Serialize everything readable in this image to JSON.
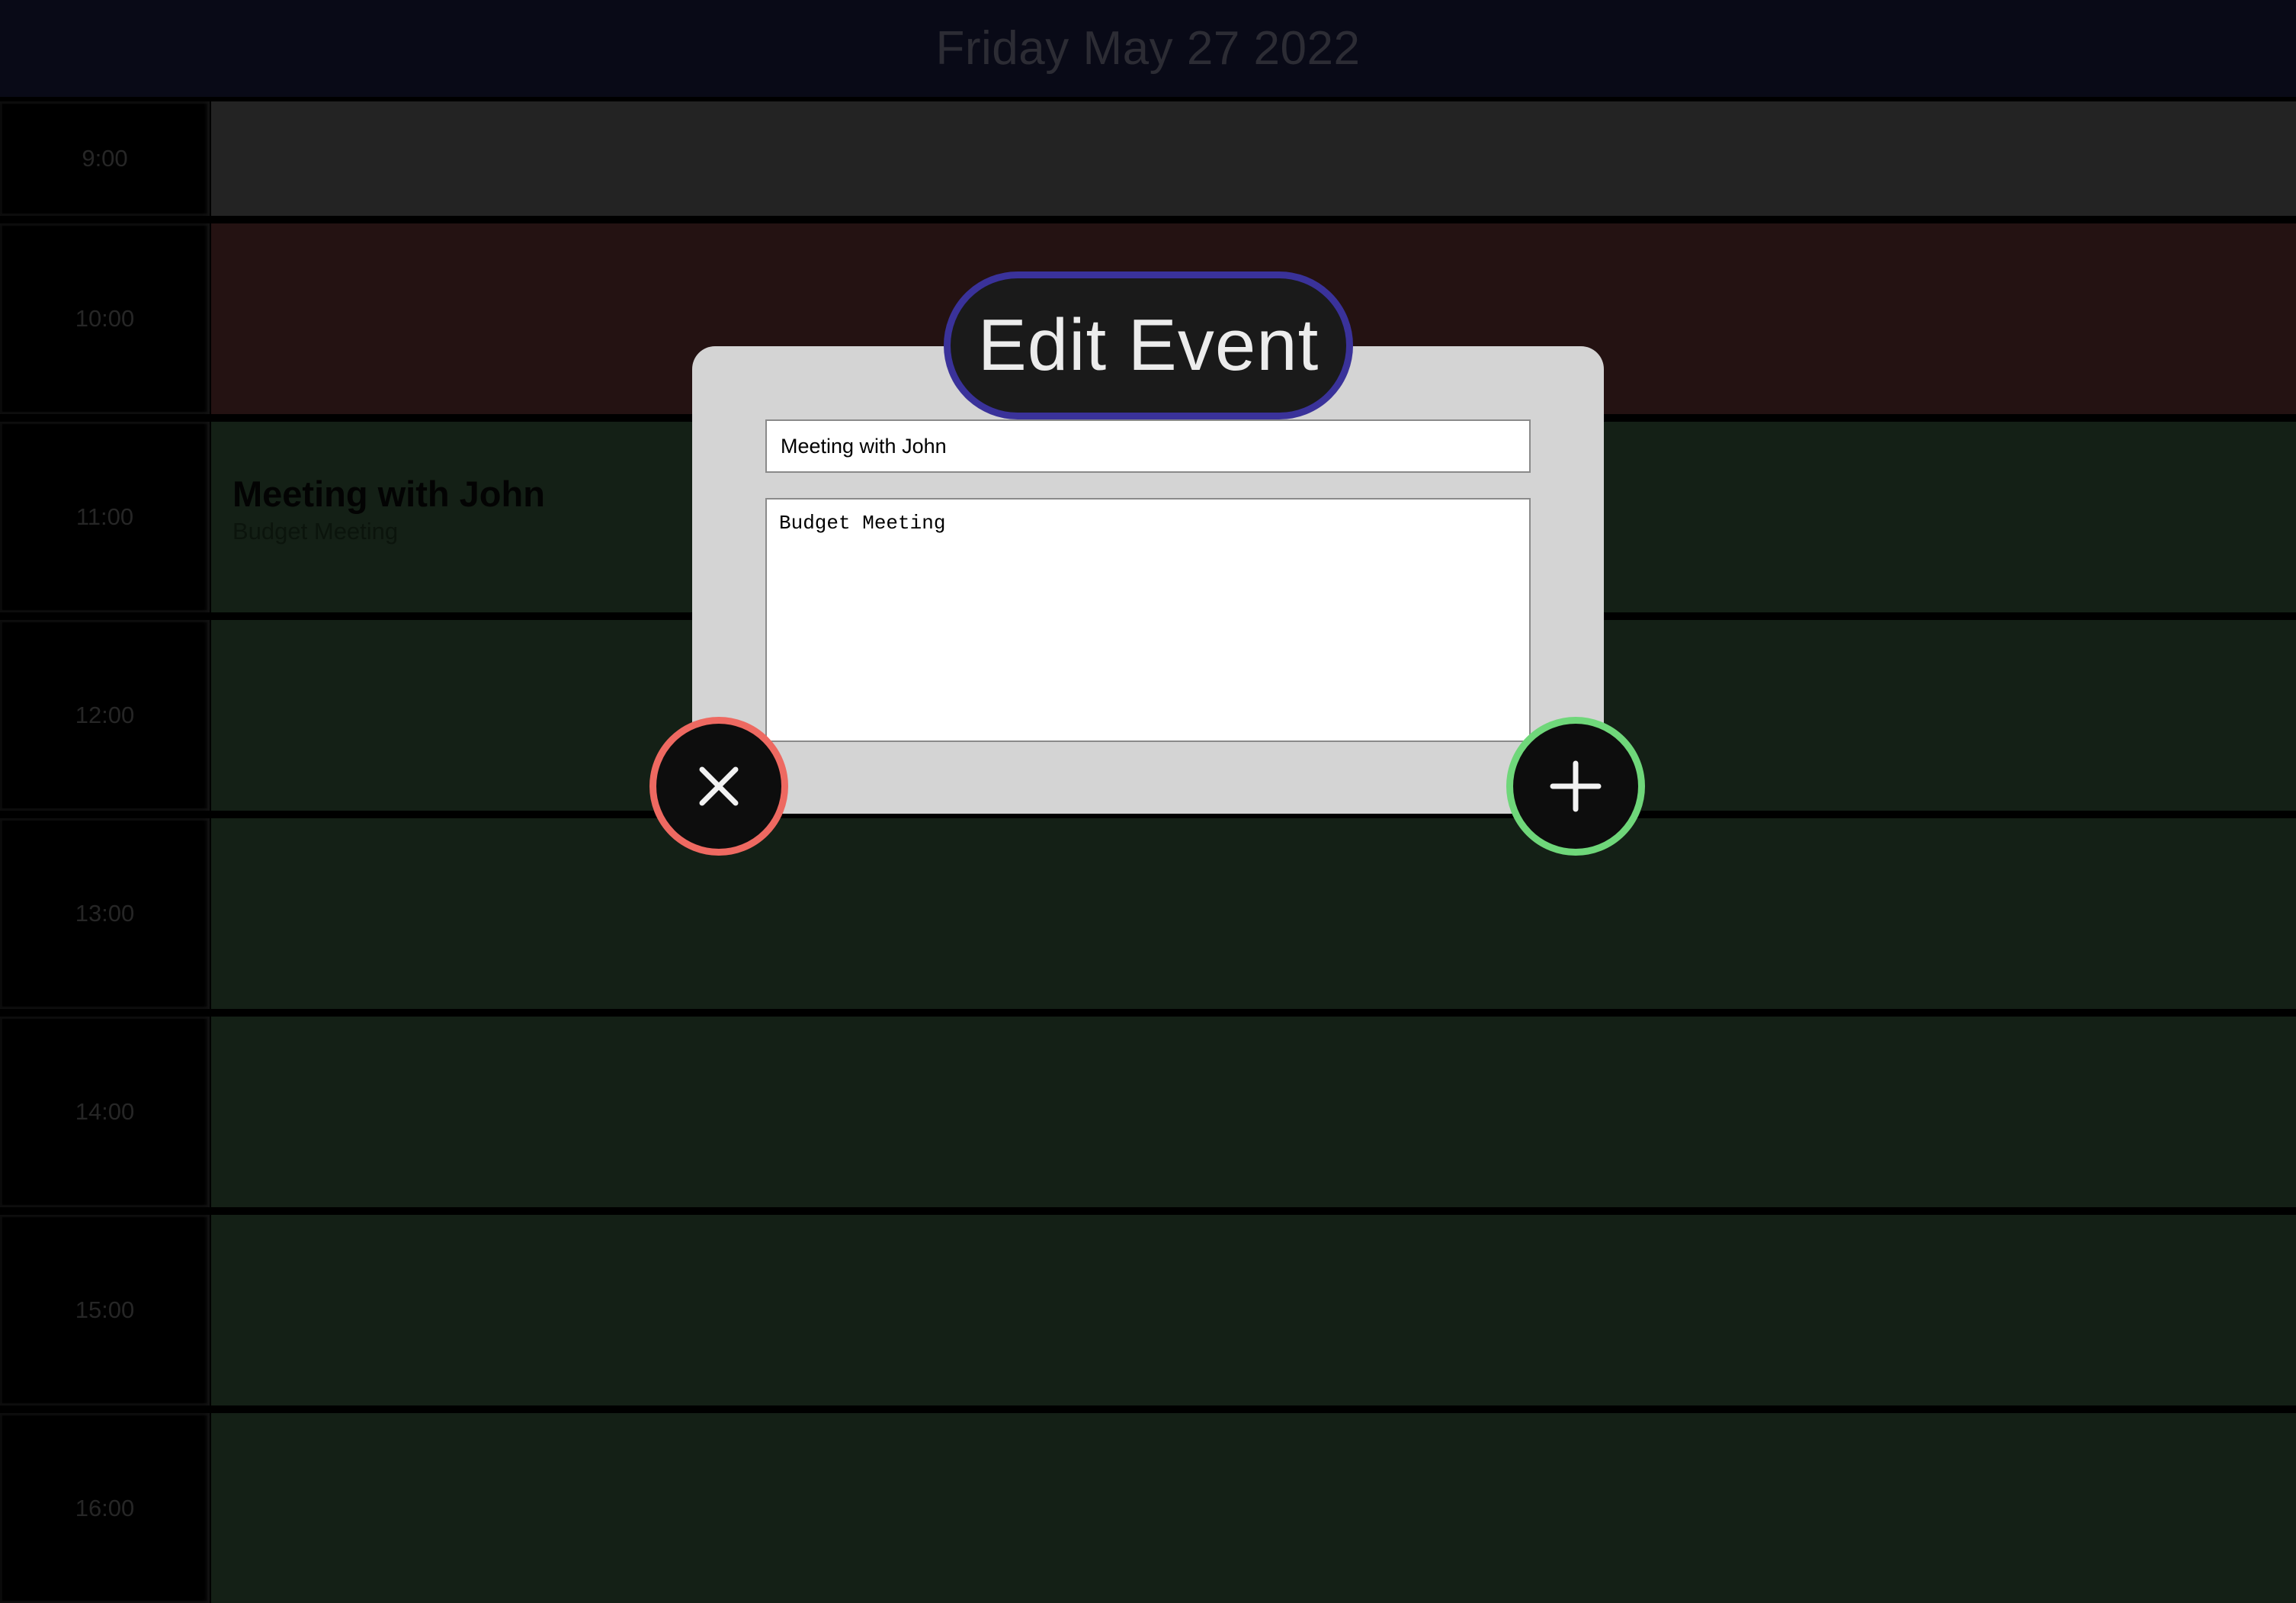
{
  "header": {
    "date": "Friday May 27 2022"
  },
  "schedule": {
    "rows": [
      {
        "time": "9:00",
        "state": "past",
        "event_title": "",
        "event_desc": ""
      },
      {
        "time": "10:00",
        "state": "present",
        "event_title": "",
        "event_desc": ""
      },
      {
        "time": "11:00",
        "state": "future",
        "event_title": "Meeting with John",
        "event_desc": "Budget Meeting"
      },
      {
        "time": "12:00",
        "state": "future",
        "event_title": "",
        "event_desc": ""
      },
      {
        "time": "13:00",
        "state": "future",
        "event_title": "",
        "event_desc": ""
      },
      {
        "time": "14:00",
        "state": "future",
        "event_title": "",
        "event_desc": ""
      },
      {
        "time": "15:00",
        "state": "future",
        "event_title": "",
        "event_desc": ""
      },
      {
        "time": "16:00",
        "state": "future",
        "event_title": "",
        "event_desc": ""
      }
    ]
  },
  "modal": {
    "title": "Edit Event",
    "title_input_value": "Meeting with John",
    "description_value": "Budget Meeting",
    "cancel_icon": "close-icon",
    "save_icon": "plus-icon"
  },
  "colors": {
    "header_bg": "#090a17",
    "past_slot": "#232323",
    "present_slot": "#241212",
    "future_slot": "#142016",
    "modal_bg": "#d4d4d4",
    "title_border": "#3a329a",
    "cancel_border": "#ee6961",
    "save_border": "#6fd77a"
  }
}
